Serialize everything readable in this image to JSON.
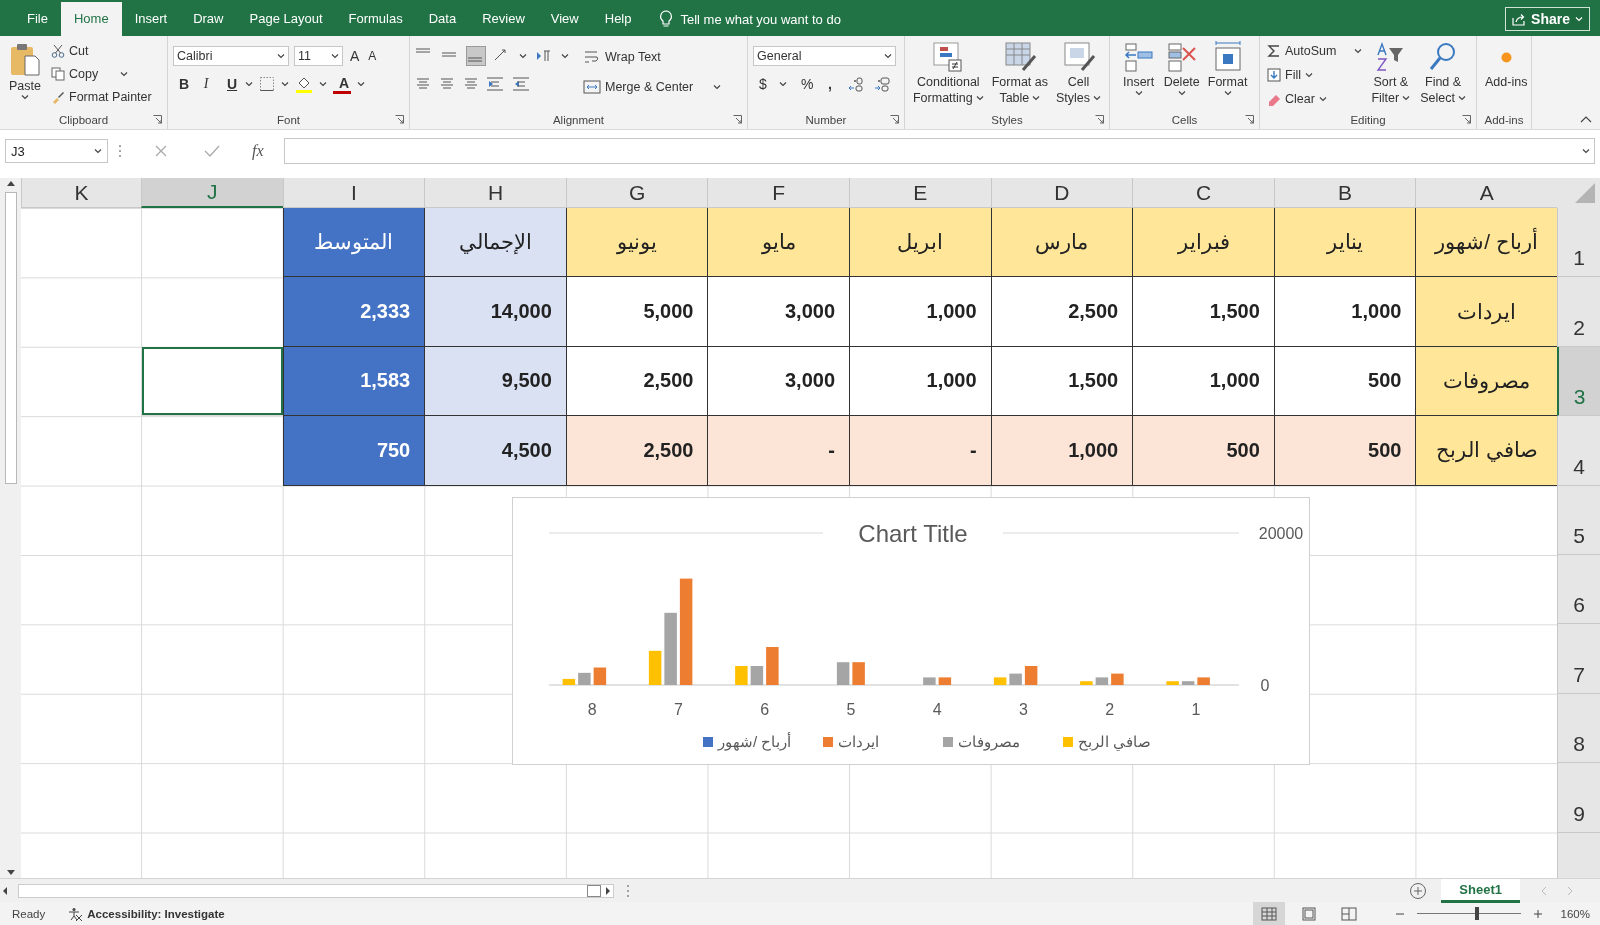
{
  "menu_tabs": [
    {
      "label": "File",
      "selected": false
    },
    {
      "label": "Home",
      "selected": true
    },
    {
      "label": "Insert",
      "selected": false
    },
    {
      "label": "Draw",
      "selected": false
    },
    {
      "label": "Page Layout",
      "selected": false
    },
    {
      "label": "Formulas",
      "selected": false
    },
    {
      "label": "Data",
      "selected": false
    },
    {
      "label": "Review",
      "selected": false
    },
    {
      "label": "View",
      "selected": false
    },
    {
      "label": "Help",
      "selected": false
    }
  ],
  "tell_me": "Tell me what you want to do",
  "share": "Share",
  "ribbon": {
    "clipboard": {
      "label": "Clipboard",
      "paste": "Paste",
      "cut": "Cut",
      "copy": "Copy",
      "format_painter": "Format Painter"
    },
    "font": {
      "label": "Font",
      "name": "Calibri",
      "size": "11",
      "grow_font": "A",
      "shrink_font": "A",
      "bold": "B",
      "italic": "I",
      "underline": "U",
      "font_color": "A"
    },
    "alignment": {
      "label": "Alignment",
      "vertical": [
        {
          "selected": false
        },
        {
          "selected": false
        },
        {
          "selected": true
        }
      ],
      "wrap_text": "Wrap Text",
      "merge": "Merge & Center"
    },
    "number": {
      "label": "Number",
      "format": "General",
      "currency": "$",
      "percent": "%",
      "comma": ","
    },
    "styles": {
      "label": "Styles",
      "buttons": [
        {
          "lines": [
            "Conditional",
            "Formatting"
          ]
        },
        {
          "lines": [
            "Format as",
            "Table"
          ]
        },
        {
          "lines": [
            "Cell",
            "Styles"
          ]
        }
      ]
    },
    "cells": {
      "label": "Cells",
      "buttons": [
        "Insert",
        "Delete",
        "Format"
      ]
    },
    "editing": {
      "label": "Editing",
      "autosum": "AutoSum",
      "fill": "Fill",
      "clear": "Clear",
      "sort": [
        "Sort &",
        "Filter"
      ],
      "find": [
        "Find &",
        "Select"
      ]
    },
    "addins": {
      "label": "Add-ins",
      "button": "Add-ins"
    }
  },
  "formula_bar": {
    "name_box": "J3",
    "function_label": "fx"
  },
  "sheet": {
    "columns": [
      {
        "label": "K",
        "selected": false
      },
      {
        "label": "J",
        "selected": true
      },
      {
        "label": "I",
        "selected": false
      },
      {
        "label": "H",
        "selected": false
      },
      {
        "label": "G",
        "selected": false
      },
      {
        "label": "F",
        "selected": false
      },
      {
        "label": "E",
        "selected": false
      },
      {
        "label": "D",
        "selected": false
      },
      {
        "label": "C",
        "selected": false
      },
      {
        "label": "B",
        "selected": false
      },
      {
        "label": "A",
        "selected": false
      }
    ],
    "row_headers": [
      {
        "label": "1",
        "selected": false
      },
      {
        "label": "2",
        "selected": false
      },
      {
        "label": "3",
        "selected": true
      },
      {
        "label": "4",
        "selected": false
      },
      {
        "label": "5",
        "selected": false
      },
      {
        "label": "6",
        "selected": false
      },
      {
        "label": "7",
        "selected": false
      },
      {
        "label": "8",
        "selected": false
      },
      {
        "label": "9",
        "selected": false
      }
    ],
    "rows": [
      {
        "cells": [
          {
            "text": "المتوسط",
            "kind": "average"
          },
          {
            "text": "الإجمالي",
            "kind": "total"
          },
          {
            "text": "يونيو",
            "kind": "label"
          },
          {
            "text": "مايو",
            "kind": "label"
          },
          {
            "text": "ابريل",
            "kind": "label"
          },
          {
            "text": "مارس",
            "kind": "label"
          },
          {
            "text": "فبراير",
            "kind": "label"
          },
          {
            "text": "يناير",
            "kind": "label"
          },
          {
            "text": "أرباح /شهور",
            "kind": "label"
          }
        ]
      },
      {
        "cells": [
          {
            "text": "2,333",
            "kind": "average"
          },
          {
            "text": "14,000",
            "kind": "total"
          },
          {
            "text": "5,000",
            "kind": "value"
          },
          {
            "text": "3,000",
            "kind": "value"
          },
          {
            "text": "1,000",
            "kind": "value"
          },
          {
            "text": "2,500",
            "kind": "value"
          },
          {
            "text": "1,500",
            "kind": "value"
          },
          {
            "text": "1,000",
            "kind": "value"
          },
          {
            "text": "ايردات",
            "kind": "label"
          }
        ]
      },
      {
        "cells": [
          {
            "text": "1,583",
            "kind": "average"
          },
          {
            "text": "9,500",
            "kind": "total"
          },
          {
            "text": "2,500",
            "kind": "value"
          },
          {
            "text": "3,000",
            "kind": "value"
          },
          {
            "text": "1,000",
            "kind": "value"
          },
          {
            "text": "1,500",
            "kind": "value"
          },
          {
            "text": "1,000",
            "kind": "value"
          },
          {
            "text": "500",
            "kind": "value"
          },
          {
            "text": "مصروفات",
            "kind": "label"
          }
        ]
      },
      {
        "cells": [
          {
            "text": "750",
            "kind": "average"
          },
          {
            "text": "4,500",
            "kind": "total"
          },
          {
            "text": "2,500",
            "kind": "net"
          },
          {
            "text": "-",
            "kind": "net"
          },
          {
            "text": "-",
            "kind": "net"
          },
          {
            "text": "1,000",
            "kind": "net"
          },
          {
            "text": "500",
            "kind": "net"
          },
          {
            "text": "500",
            "kind": "net"
          },
          {
            "text": "صافي الربح",
            "kind": "label"
          }
        ]
      }
    ],
    "chart": {
      "chart_data": {
        "type": "bar",
        "title": "Chart Title",
        "categories": [
          "8",
          "7",
          "6",
          "5",
          "4",
          "3",
          "2",
          "1"
        ],
        "series": [
          {
            "name": "أرباح /شهور",
            "color": "#4472c4",
            "values": [
              null,
              null,
              null,
              null,
              null,
              null,
              null,
              null
            ]
          },
          {
            "name": "ايردات",
            "color": "#ed7d31",
            "values": [
              2300,
              14000,
              5000,
              3000,
              1000,
              2500,
              1500,
              1000
            ]
          },
          {
            "name": "مصروفات",
            "color": "#a5a5a5",
            "values": [
              1600,
              9500,
              2500,
              3000,
              1000,
              1500,
              1000,
              500
            ]
          },
          {
            "name": "صافي الربح",
            "color": "#ffc000",
            "values": [
              800,
              4500,
              2500,
              0,
              0,
              1000,
              500,
              500
            ]
          }
        ],
        "ylim": [
          0,
          20000
        ],
        "yticks": [
          0,
          20000
        ],
        "legend": "bottom"
      }
    }
  },
  "sheet_tabs": [
    {
      "label": "Sheet1",
      "selected": true
    }
  ],
  "status_bar": {
    "ready": "Ready",
    "accessibility": "Accessibility: Investigate",
    "views": [
      {
        "selected": true
      },
      {
        "selected": false
      },
      {
        "selected": false
      }
    ],
    "zoom": {
      "level": 0.58,
      "reading": "160%"
    }
  }
}
